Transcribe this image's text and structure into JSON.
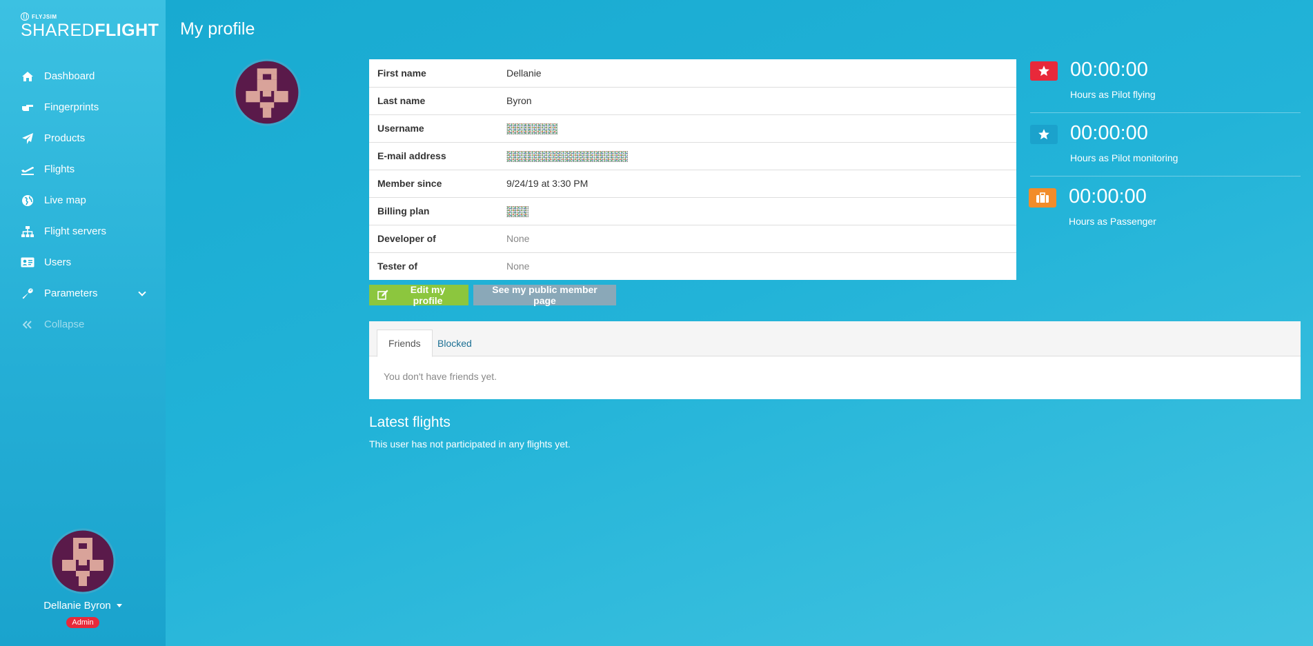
{
  "app": {
    "logo_small": "FLYJSIM",
    "logo_thin": "SHARED",
    "logo_bold": "FLIGHT"
  },
  "sidebar": {
    "items": [
      {
        "label": "Dashboard",
        "icon": "home-icon"
      },
      {
        "label": "Fingerprints",
        "icon": "hand-pointing-icon"
      },
      {
        "label": "Products",
        "icon": "paper-plane-icon"
      },
      {
        "label": "Flights",
        "icon": "plane-takeoff-icon"
      },
      {
        "label": "Live map",
        "icon": "globe-icon"
      },
      {
        "label": "Flight servers",
        "icon": "sitemap-icon"
      },
      {
        "label": "Users",
        "icon": "id-card-icon"
      },
      {
        "label": "Parameters",
        "icon": "wrench-icon"
      },
      {
        "label": "Collapse",
        "icon": "double-chevron-left-icon"
      }
    ]
  },
  "user": {
    "name": "Dellanie Byron",
    "role": "Admin"
  },
  "page": {
    "title": "My profile"
  },
  "profile": {
    "rows": [
      {
        "key": "First name",
        "value": "Dellanie"
      },
      {
        "key": "Last name",
        "value": "Byron"
      },
      {
        "key": "Username",
        "value": ""
      },
      {
        "key": "E-mail address",
        "value": ""
      },
      {
        "key": "Member since",
        "value": "9/24/19 at 3:30 PM"
      },
      {
        "key": "Billing plan",
        "value": ""
      },
      {
        "key": "Developer of",
        "value": "None"
      },
      {
        "key": "Tester of",
        "value": "None"
      }
    ],
    "edit_label": "Edit my profile",
    "public_label": "See my public member page"
  },
  "tabs": {
    "friends_label": "Friends",
    "blocked_label": "Blocked",
    "friends_empty": "You don't have friends yet."
  },
  "latest": {
    "title": "Latest flights",
    "empty": "This user has not participated in any flights yet."
  },
  "stats": [
    {
      "time": "00:00:00",
      "label": "Hours as Pilot flying",
      "color": "#e8293a",
      "icon": "star-icon"
    },
    {
      "time": "00:00:00",
      "label": "Hours as Pilot monitoring",
      "color": "#1ba2cc",
      "icon": "star-icon"
    },
    {
      "time": "00:00:00",
      "label": "Hours as Passenger",
      "color": "#f28c2a",
      "icon": "suitcase-icon"
    }
  ],
  "colors": {
    "avatar_bg": "#5a1a4a",
    "avatar_fg": "#d9a39a",
    "edit_button": "#8cc63e",
    "public_button": "#8aa8b8",
    "admin_badge": "#e8293a"
  }
}
